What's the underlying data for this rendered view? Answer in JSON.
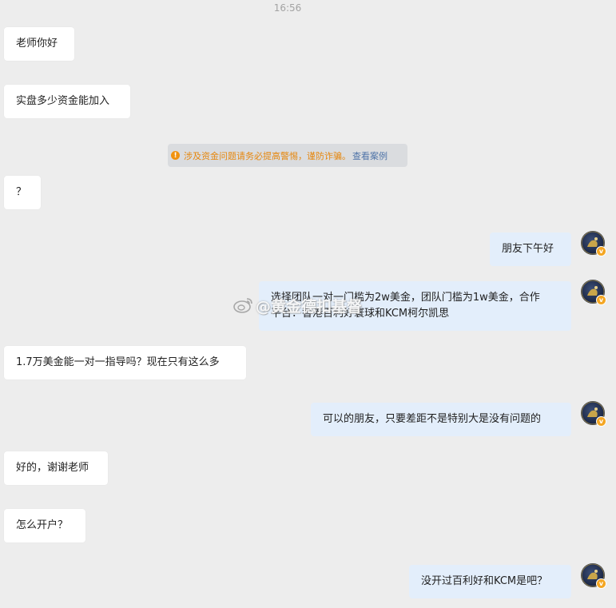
{
  "timestamp": "16:56",
  "messages": {
    "m1": "老师你好",
    "m2": "实盘多少资金能加入",
    "m3": "？",
    "m4": "朋友下午好",
    "m5_line1": "选择团队一对一门槛为2w美金，团队门槛为1w美金，合作",
    "m5_line2": "平台：香港百利好寰球和KCM柯尔凯思",
    "m6": "1.7万美金能一对一指导吗？现在只有这么多",
    "m7": "可以的朋友，只要差距不是特别大是没有问题的",
    "m8": "好的，谢谢老师",
    "m9": "怎么开户？",
    "m10": "没开过百利好和KCM是吧？"
  },
  "notice": {
    "text": "涉及资金问题请务必提高警惕，谨防诈骗。",
    "link": "查看案例"
  },
  "watermark": "@黄金德扣基督",
  "colors": {
    "background": "#ededed",
    "left_bubble": "#ffffff",
    "right_bubble": "#e3eefb",
    "notice_text": "#e6870e",
    "notice_link": "#4f74a8",
    "verified_badge": "#f4a623"
  }
}
